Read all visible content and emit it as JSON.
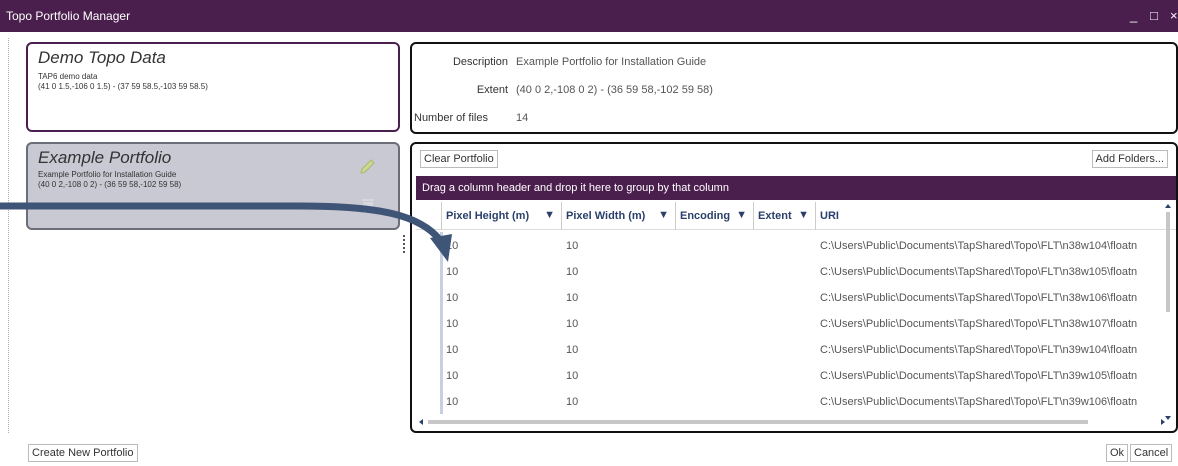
{
  "window": {
    "title": "Topo Portfolio Manager",
    "minimize": "_",
    "maximize": "□",
    "close": "×"
  },
  "portfolios": [
    {
      "name": "Demo Topo Data",
      "line1": "TAP6 demo data",
      "line2": "(41 0 1.5,-106 0 1.5) - (37 59 58.5,-103 59 58.5)"
    },
    {
      "name": "Example Portfolio",
      "line1": "Example Portfolio for Installation Guide",
      "line2": "(40 0 2,-108 0 2) - (36 59 58,-102 59 58)"
    }
  ],
  "details": {
    "description_label": "Description",
    "description_value": "Example Portfolio for Installation Guide",
    "extent_label": "Extent",
    "extent_value": "(40 0 2,-108 0 2) - (36 59 58,-102 59 58)",
    "files_label": "Number of files",
    "files_value": "14"
  },
  "toolbar": {
    "clear": "Clear Portfolio",
    "add": "Add Folders..."
  },
  "grid": {
    "group_hint": "Drag a column header and drop it here to group by that column",
    "columns": [
      "Pixel Height (m)",
      "Pixel Width (m)",
      "Encoding",
      "Extent",
      "URI"
    ],
    "rows": [
      [
        "10",
        "10",
        "",
        "",
        "C:\\Users\\Public\\Documents\\TapShared\\Topo\\FLT\\n38w104\\floatn"
      ],
      [
        "10",
        "10",
        "",
        "",
        "C:\\Users\\Public\\Documents\\TapShared\\Topo\\FLT\\n38w105\\floatn"
      ],
      [
        "10",
        "10",
        "",
        "",
        "C:\\Users\\Public\\Documents\\TapShared\\Topo\\FLT\\n38w106\\floatn"
      ],
      [
        "10",
        "10",
        "",
        "",
        "C:\\Users\\Public\\Documents\\TapShared\\Topo\\FLT\\n38w107\\floatn"
      ],
      [
        "10",
        "10",
        "",
        "",
        "C:\\Users\\Public\\Documents\\TapShared\\Topo\\FLT\\n39w104\\floatn"
      ],
      [
        "10",
        "10",
        "",
        "",
        "C:\\Users\\Public\\Documents\\TapShared\\Topo\\FLT\\n39w105\\floatn"
      ],
      [
        "10",
        "10",
        "",
        "",
        "C:\\Users\\Public\\Documents\\TapShared\\Topo\\FLT\\n39w106\\floatn"
      ]
    ]
  },
  "footer": {
    "create": "Create New Portfolio",
    "ok": "Ok",
    "cancel": "Cancel"
  },
  "colors": {
    "accent": "#4b1f4d",
    "selected": "#c8c9d2",
    "arrow": "#3f5578"
  }
}
